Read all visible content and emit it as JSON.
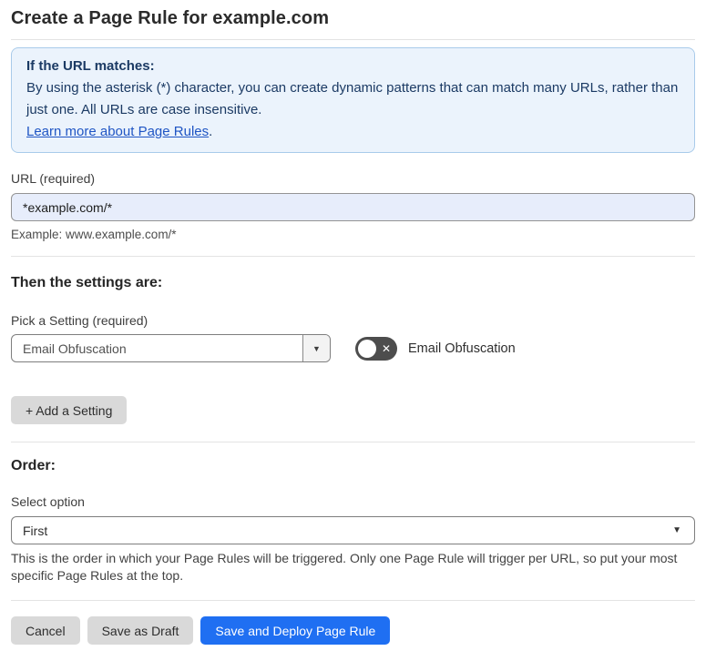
{
  "header": {
    "title": "Create a Page Rule for example.com"
  },
  "info_box": {
    "heading": "If the URL matches:",
    "body": "By using the asterisk (*) character, you can create dynamic patterns that can match many URLs, rather than just one. All URLs are case insensitive.",
    "link_label": "Learn more about Page Rules",
    "link_suffix": "."
  },
  "url_field": {
    "label": "URL (required)",
    "value": "*example.com/*",
    "helper": "Example: www.example.com/*"
  },
  "settings_section": {
    "heading": "Then the settings are:",
    "picker_label": "Pick a Setting (required)",
    "picker_value": "Email Obfuscation",
    "toggle_label": "Email Obfuscation",
    "toggle_state": "off",
    "add_button_label": "+ Add a Setting"
  },
  "order_section": {
    "heading": "Order:",
    "select_label": "Select option",
    "select_value": "First",
    "helper": "This is the order in which your Page Rules will be triggered. Only one Page Rule will trigger per URL, so put your most specific Page Rules at the top."
  },
  "footer": {
    "cancel_label": "Cancel",
    "save_draft_label": "Save as Draft",
    "save_deploy_label": "Save and Deploy Page Rule"
  },
  "icons": {
    "picker_dropdown_arrow": "▼",
    "order_dropdown_caret": "▼",
    "toggle_off_x": "✕"
  },
  "colors": {
    "accent_blue": "#1f6ff2",
    "info_bg": "#ebf3fc",
    "info_border": "#a9cbea",
    "info_text": "#1b3a64",
    "link_blue": "#1f55c4",
    "input_bg": "#e7edfb",
    "divider": "#e3e3e3"
  }
}
